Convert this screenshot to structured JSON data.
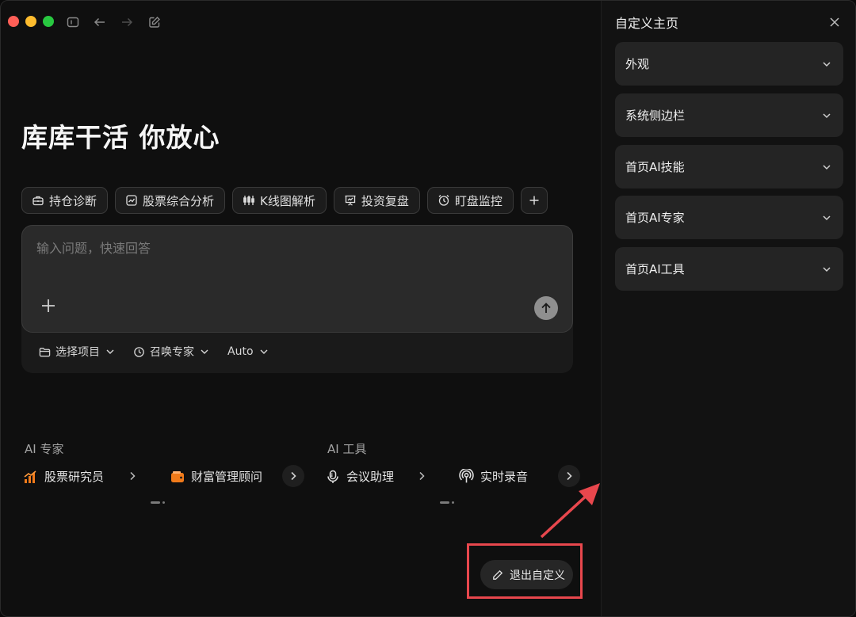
{
  "main": {
    "hero_title": "库库干活 你放心",
    "chips": [
      {
        "label": "持仓诊断",
        "icon": "briefcase-icon"
      },
      {
        "label": "股票综合分析",
        "icon": "chart-icon"
      },
      {
        "label": "K线图解析",
        "icon": "candlestick-icon"
      },
      {
        "label": "投资复盘",
        "icon": "presentation-icon"
      },
      {
        "label": "盯盘监控",
        "icon": "alarm-clock-icon"
      }
    ],
    "input_placeholder": "输入问题，快速回答",
    "options": [
      {
        "label": "选择项目",
        "icon": "folder-icon"
      },
      {
        "label": "召唤专家",
        "icon": "expert-icon"
      },
      {
        "label": "Auto"
      }
    ],
    "ai_experts": {
      "label": "AI 专家",
      "items": [
        {
          "label": "股票研究员",
          "icon": "bar-chart-icon"
        },
        {
          "label": "财富管理顾问",
          "icon": "wallet-icon"
        }
      ]
    },
    "ai_tools": {
      "label": "AI 工具",
      "items": [
        {
          "label": "会议助理",
          "icon": "microphone-icon"
        },
        {
          "label": "实时录音",
          "icon": "podcast-icon"
        }
      ]
    },
    "exit_button": "退出自定义"
  },
  "panel": {
    "title": "自定义主页",
    "sections": [
      "外观",
      "系统侧边栏",
      "首页AI技能",
      "首页AI专家",
      "首页AI工具"
    ]
  },
  "colors": {
    "annotation_red": "#e8474d",
    "accent_orange": "#f07a1a"
  }
}
